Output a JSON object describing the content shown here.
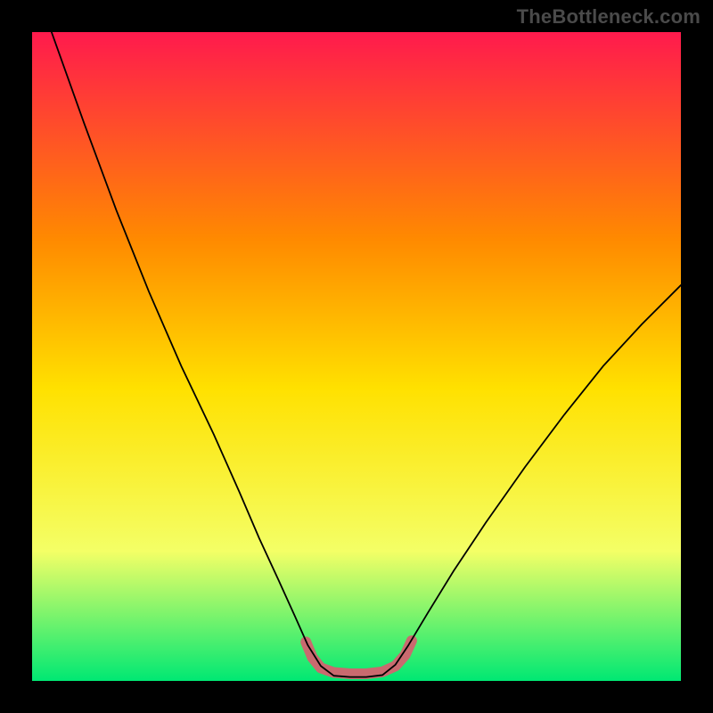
{
  "watermark": "TheBottleneck.com",
  "chart_data": {
    "type": "line",
    "title": "",
    "xlabel": "",
    "ylabel": "",
    "xlim": [
      0,
      100
    ],
    "ylim": [
      0,
      100
    ],
    "background_gradient": {
      "top_color": "#ff1a4d",
      "mid_upper_color": "#ff8a00",
      "mid_color": "#ffe100",
      "mid_lower_color": "#f4ff66",
      "bottom_color": "#00e873"
    },
    "series": [
      {
        "name": "bottleneck-curve",
        "color": "#000000",
        "stroke_width": 1.8,
        "points": [
          {
            "x": 3.0,
            "y": 100.0
          },
          {
            "x": 8.0,
            "y": 86.0
          },
          {
            "x": 13.0,
            "y": 72.5
          },
          {
            "x": 18.0,
            "y": 60.0
          },
          {
            "x": 23.0,
            "y": 48.5
          },
          {
            "x": 28.0,
            "y": 38.0
          },
          {
            "x": 32.0,
            "y": 29.0
          },
          {
            "x": 35.0,
            "y": 22.0
          },
          {
            "x": 38.0,
            "y": 15.5
          },
          {
            "x": 40.5,
            "y": 10.0
          },
          {
            "x": 42.5,
            "y": 5.5
          },
          {
            "x": 44.5,
            "y": 2.3
          },
          {
            "x": 46.5,
            "y": 0.8
          },
          {
            "x": 49.0,
            "y": 0.6
          },
          {
            "x": 51.5,
            "y": 0.6
          },
          {
            "x": 54.0,
            "y": 0.9
          },
          {
            "x": 56.0,
            "y": 2.5
          },
          {
            "x": 58.0,
            "y": 5.5
          },
          {
            "x": 61.0,
            "y": 10.5
          },
          {
            "x": 65.0,
            "y": 17.0
          },
          {
            "x": 70.0,
            "y": 24.5
          },
          {
            "x": 76.0,
            "y": 33.0
          },
          {
            "x": 82.0,
            "y": 41.0
          },
          {
            "x": 88.0,
            "y": 48.5
          },
          {
            "x": 94.0,
            "y": 55.0
          },
          {
            "x": 100.0,
            "y": 61.0
          }
        ]
      },
      {
        "name": "valley-highlight",
        "color": "#c96a6f",
        "stroke_width": 12,
        "linecap": "round",
        "points": [
          {
            "x": 42.2,
            "y": 6.0
          },
          {
            "x": 43.2,
            "y": 3.6
          },
          {
            "x": 44.5,
            "y": 2.0
          },
          {
            "x": 46.5,
            "y": 1.3
          },
          {
            "x": 49.0,
            "y": 1.1
          },
          {
            "x": 51.5,
            "y": 1.1
          },
          {
            "x": 54.0,
            "y": 1.4
          },
          {
            "x": 56.0,
            "y": 2.3
          },
          {
            "x": 57.5,
            "y": 4.0
          },
          {
            "x": 58.5,
            "y": 6.2
          }
        ]
      }
    ]
  }
}
